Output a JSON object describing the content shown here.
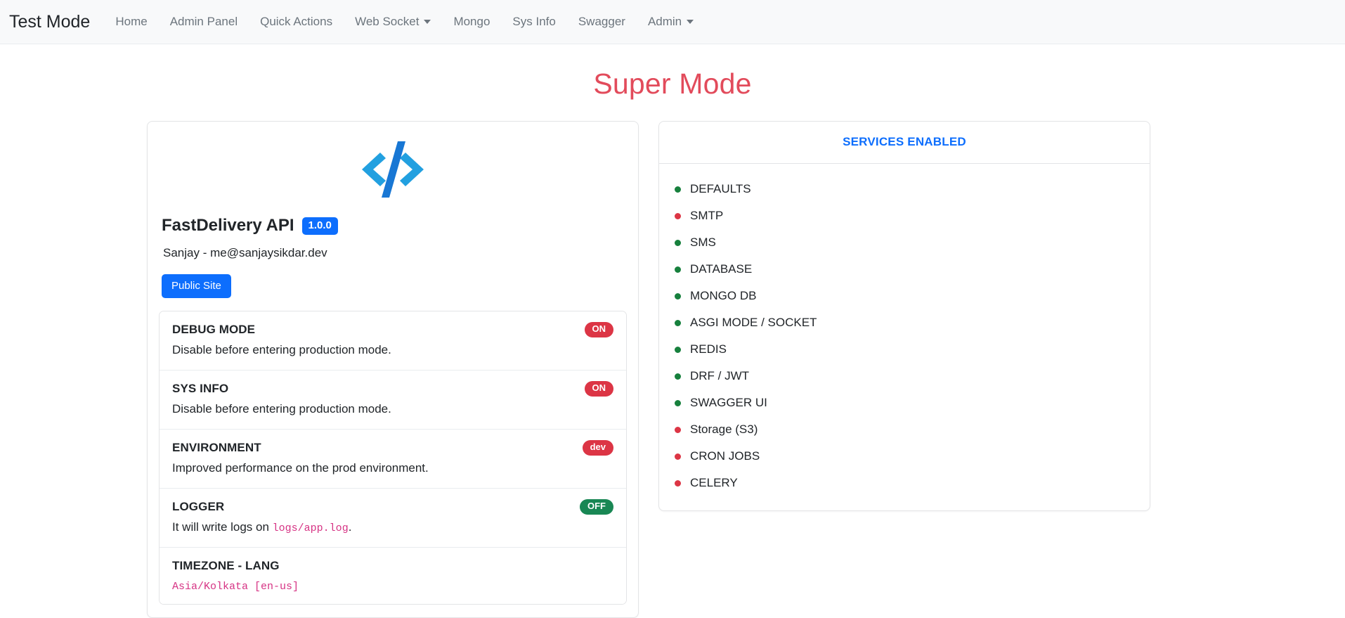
{
  "navbar": {
    "brand": "Test Mode",
    "items": [
      {
        "label": "Home",
        "dropdown": false
      },
      {
        "label": "Admin Panel",
        "dropdown": false
      },
      {
        "label": "Quick Actions",
        "dropdown": false
      },
      {
        "label": "Web Socket",
        "dropdown": true
      },
      {
        "label": "Mongo",
        "dropdown": false
      },
      {
        "label": "Sys Info",
        "dropdown": false
      },
      {
        "label": "Swagger",
        "dropdown": false
      },
      {
        "label": "Admin",
        "dropdown": true
      }
    ]
  },
  "page": {
    "title": "Super Mode",
    "title_color": "#e24b5b"
  },
  "info_card": {
    "logo_icon": "code-brackets-icon",
    "logo_colors": {
      "slash": "#1877d4",
      "brackets": "#22a0e0"
    },
    "api_name": "FastDelivery API",
    "version": "1.0.0",
    "author": "Sanjay - me@sanjaysikdar.dev",
    "public_site_label": "Public Site",
    "accent": "#0d6efd",
    "settings": [
      {
        "title": "DEBUG MODE",
        "description": "Disable before entering production mode.",
        "badge": "ON",
        "badge_state": "danger"
      },
      {
        "title": "SYS INFO",
        "description": "Disable before entering production mode.",
        "badge": "ON",
        "badge_state": "danger"
      },
      {
        "title": "ENVIRONMENT",
        "description": "Improved performance on the prod environment.",
        "badge": "dev",
        "badge_state": "danger"
      },
      {
        "title": "LOGGER",
        "desc_prefix": "It will write logs on ",
        "desc_code": "logs/app.log",
        "desc_suffix": ".",
        "badge": "OFF",
        "badge_state": "success"
      },
      {
        "title": "TIMEZONE - LANG",
        "mono_value": "Asia/Kolkata [en-us]"
      }
    ]
  },
  "services_card": {
    "header": "SERVICES ENABLED",
    "header_color": "#0d6efd",
    "on_color": "#17803d",
    "off_color": "#dc3545",
    "items": [
      {
        "label": "DEFAULTS",
        "status": "on"
      },
      {
        "label": "SMTP",
        "status": "off"
      },
      {
        "label": "SMS",
        "status": "on"
      },
      {
        "label": "DATABASE",
        "status": "on"
      },
      {
        "label": "MONGO DB",
        "status": "on"
      },
      {
        "label": "ASGI MODE / SOCKET",
        "status": "on"
      },
      {
        "label": "REDIS",
        "status": "on"
      },
      {
        "label": "DRF / JWT",
        "status": "on"
      },
      {
        "label": "SWAGGER UI",
        "status": "on"
      },
      {
        "label": "Storage (S3)",
        "status": "off"
      },
      {
        "label": "CRON JOBS",
        "status": "off"
      },
      {
        "label": "CELERY",
        "status": "off"
      }
    ]
  }
}
